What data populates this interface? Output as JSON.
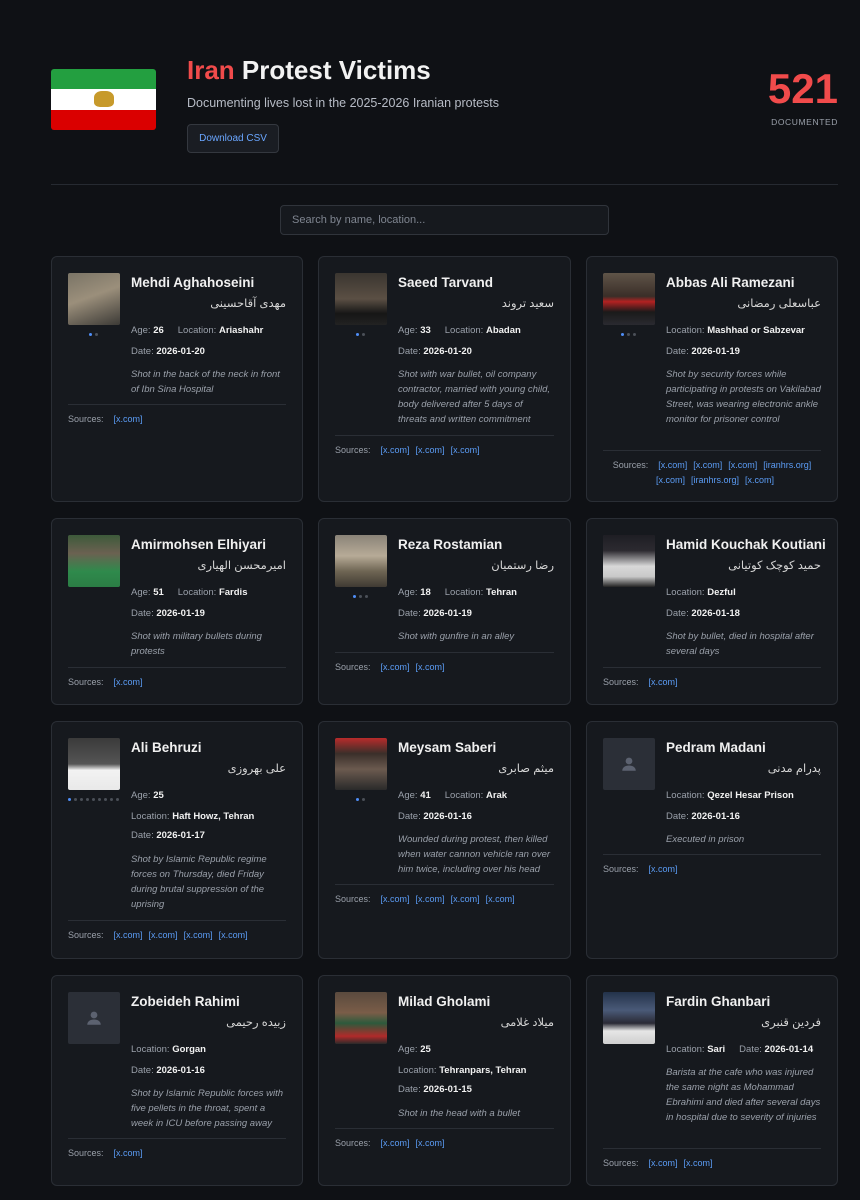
{
  "header": {
    "title_accent": "Iran",
    "title_rest": "Protest Victims",
    "subtitle": "Documenting lives lost in the 2025-2026 Iranian protests",
    "download_label": "Download CSV",
    "count": "521",
    "count_label": "DOCUMENTED"
  },
  "search": {
    "placeholder": "Search by name, location..."
  },
  "labels": {
    "age": "Age:",
    "location": "Location:",
    "date": "Date:",
    "sources": "Sources:"
  },
  "colors": {
    "accent_red": "#f14b4b",
    "link_blue": "#5b9cf5",
    "background": "#0f1115",
    "card": "#16191e"
  },
  "victims": [
    {
      "name": "Mehdi Aghahoseini",
      "native": "مهدی آقاحسینی",
      "age": "26",
      "location": "Ariashahr",
      "date": "2026-01-20",
      "description": "Shot in the back of the neck in front of Ibn Sina Hospital",
      "sources": [
        "[x.com]"
      ]
    },
    {
      "name": "Saeed Tarvand",
      "native": "سعید تروند",
      "age": "33",
      "location": "Abadan",
      "date": "2026-01-20",
      "description": "Shot with war bullet, oil company contractor, married with young child, body delivered after 5 days of threats and written commitment",
      "sources": [
        "[x.com]",
        "[x.com]",
        "[x.com]"
      ]
    },
    {
      "name": "Abbas Ali Ramezani",
      "native": "عباسعلی رمضانی",
      "location": "Mashhad or Sabzevar",
      "date": "2026-01-19",
      "description": "Shot by security forces while participating in protests on Vakilabad Street, was wearing electronic ankle monitor for prisoner control",
      "sources": [
        "[x.com]",
        "[x.com]",
        "[x.com]",
        "[iranhrs.org]",
        "[x.com]",
        "[iranhrs.org]",
        "[x.com]"
      ]
    },
    {
      "name": "Amirmohsen Elhiyari",
      "native": "امیرمحسن الهیاری",
      "age": "51",
      "location": "Fardis",
      "date": "2026-01-19",
      "description": "Shot with military bullets during protests",
      "sources": [
        "[x.com]"
      ]
    },
    {
      "name": "Reza Rostamian",
      "native": "رضا رستمیان",
      "age": "18",
      "location": "Tehran",
      "date": "2026-01-19",
      "description": "Shot with gunfire in an alley",
      "sources": [
        "[x.com]",
        "[x.com]"
      ]
    },
    {
      "name": "Hamid Kouchak Koutiani",
      "native": "حمید کوچک کوتیانی",
      "location": "Dezful",
      "date": "2026-01-18",
      "description": "Shot by bullet, died in hospital after several days",
      "sources": [
        "[x.com]"
      ]
    },
    {
      "name": "Ali Behruzi",
      "native": "علی بهروزی",
      "age": "25",
      "location": "Haft Howz, Tehran",
      "date": "2026-01-17",
      "description": "Shot by Islamic Republic regime forces on Thursday, died Friday during brutal suppression of the uprising",
      "sources": [
        "[x.com]",
        "[x.com]",
        "[x.com]",
        "[x.com]"
      ]
    },
    {
      "name": "Meysam Saberi",
      "native": "میثم صابری",
      "age": "41",
      "location": "Arak",
      "date": "2026-01-16",
      "description": "Wounded during protest, then killed when water cannon vehicle ran over him twice, including over his head",
      "sources": [
        "[x.com]",
        "[x.com]",
        "[x.com]",
        "[x.com]"
      ]
    },
    {
      "name": "Pedram Madani",
      "native": "پدرام مدنی",
      "location": "Qezel Hesar Prison",
      "date": "2026-01-16",
      "description": "Executed in prison",
      "sources": [
        "[x.com]"
      ]
    },
    {
      "name": "Zobeideh Rahimi",
      "native": "زبیده رحیمی",
      "location": "Gorgan",
      "date": "2026-01-16",
      "description": "Shot by Islamic Republic forces with five pellets in the throat, spent a week in ICU before passing away",
      "sources": [
        "[x.com]"
      ]
    },
    {
      "name": "Milad Gholami",
      "native": "میلاد غلامی",
      "age": "25",
      "location": "Tehranpars, Tehran",
      "date": "2026-01-15",
      "description": "Shot in the head with a bullet",
      "sources": [
        "[x.com]",
        "[x.com]"
      ]
    },
    {
      "name": "Fardin Ghanbari",
      "native": "فردین قنبری",
      "location": "Sari",
      "date": "2026-01-14",
      "description": "Barista at the cafe who was injured the same night as Mohammad Ebrahimi and died after several days in hospital due to severity of injuries",
      "sources": [
        "[x.com]",
        "[x.com]"
      ]
    }
  ]
}
